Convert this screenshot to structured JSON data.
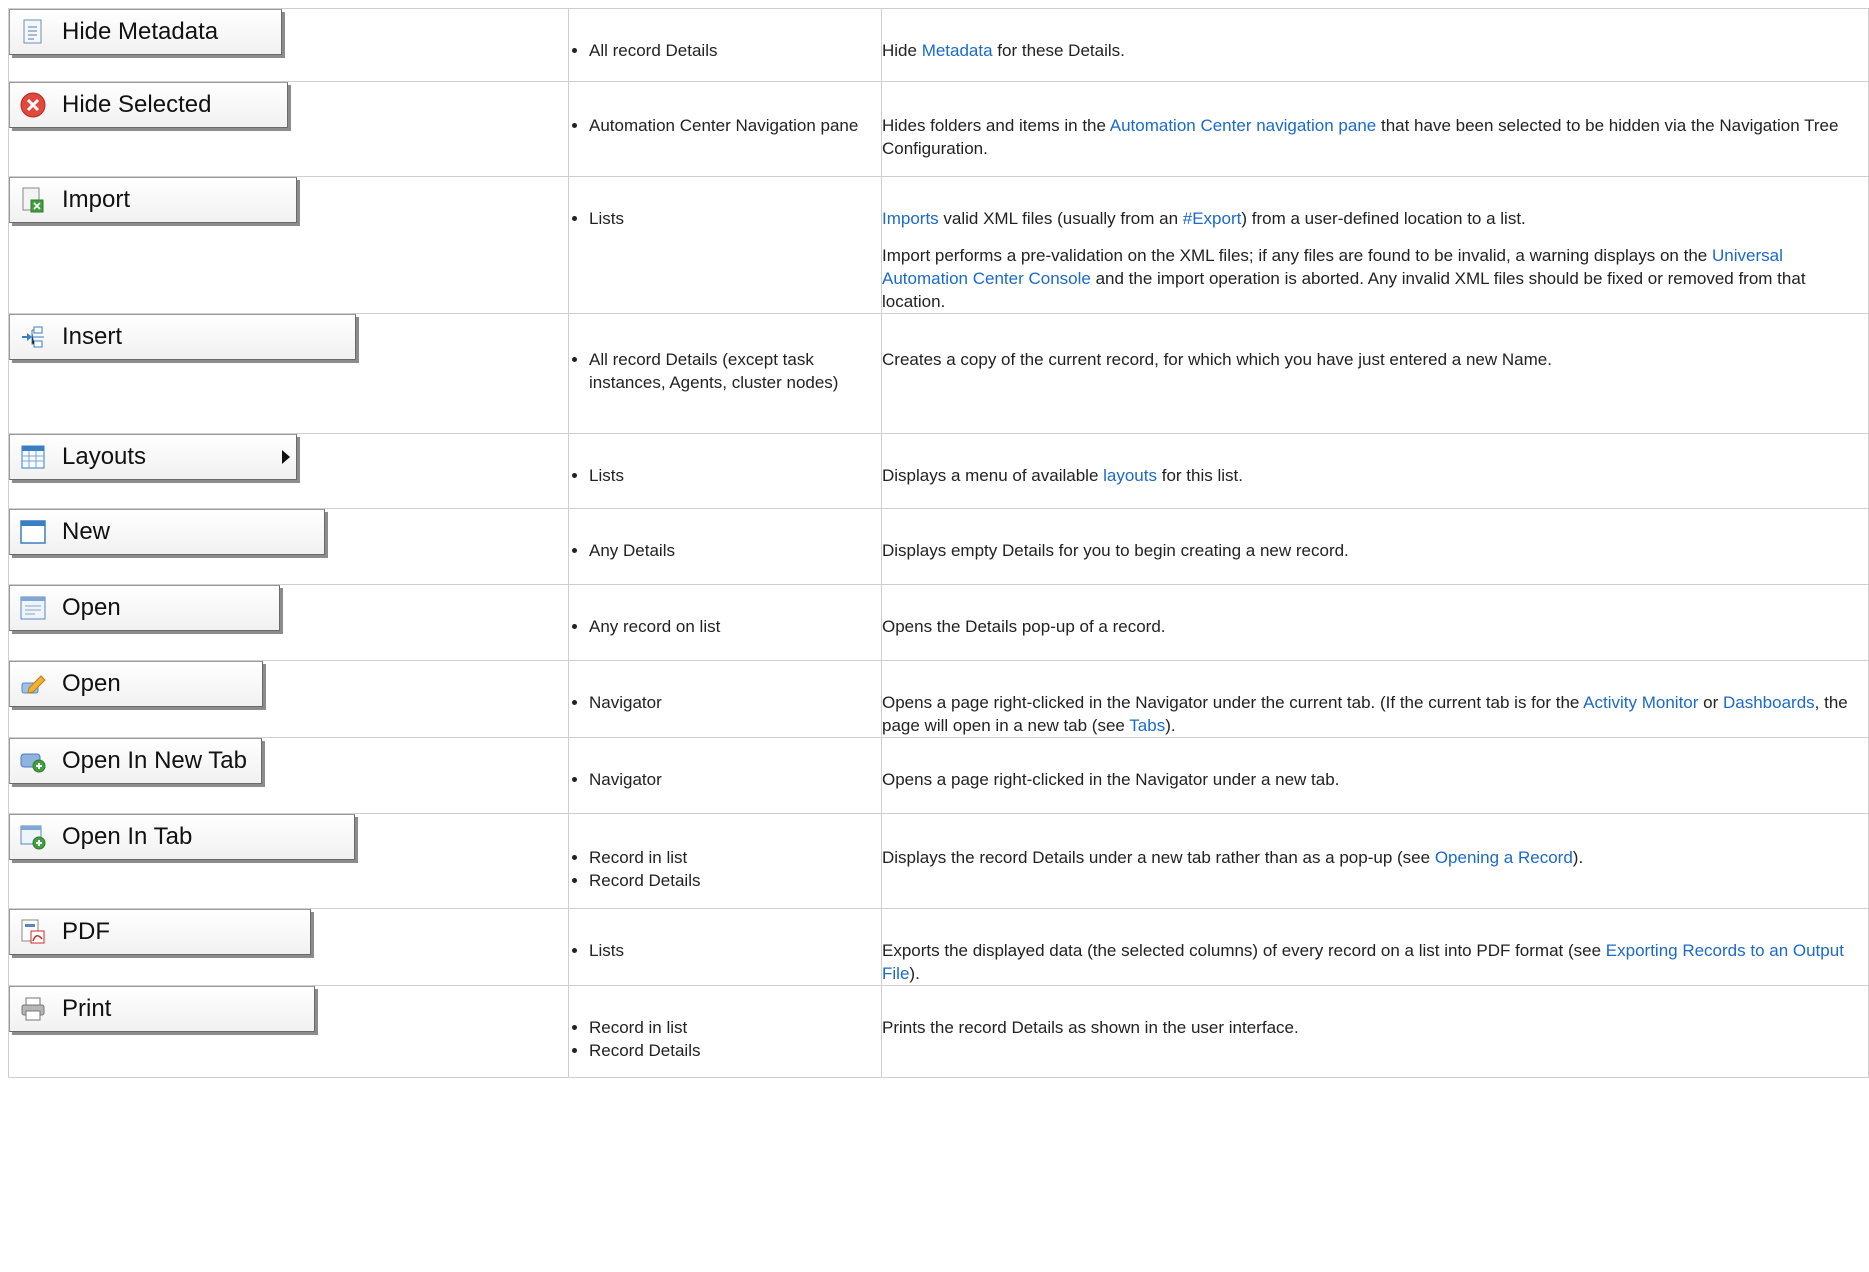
{
  "rows": [
    {
      "button": "Hide Metadata",
      "icon": "document-icon",
      "context": [
        "All record Details"
      ],
      "desc": [
        [
          "Hide ",
          ""
        ],
        [
          "Metadata",
          "link"
        ],
        [
          " for these Details.",
          ""
        ]
      ]
    },
    {
      "button": "Hide Selected",
      "icon": "red-x-circle-icon",
      "context": [
        "Automation Center Navigation pane"
      ],
      "desc": [
        [
          "Hides folders and items in the ",
          ""
        ],
        [
          "Automation Center navigation pane",
          "link"
        ],
        [
          " that have been selected to be hidden via the Navigation Tree Configuration.",
          ""
        ]
      ]
    },
    {
      "button": "Import",
      "icon": "import-icon",
      "context": [
        "Lists"
      ],
      "desc": [
        [
          "Imports",
          "link"
        ],
        [
          " valid XML files (usually from an ",
          ""
        ],
        [
          "#Export",
          "link"
        ],
        [
          ") from a user-defined location to a list.",
          ""
        ]
      ],
      "desc2": [
        [
          "Import performs a pre-validation on the XML files; if any files are found to be invalid, a warning displays on the ",
          ""
        ],
        [
          "Universal Automation Center Console",
          "link"
        ],
        [
          " and the import operation is aborted. Any invalid XML files should be fixed or removed from that location.",
          ""
        ]
      ]
    },
    {
      "button": "Insert",
      "icon": "insert-tree-icon",
      "context": [
        "All record Details (except task instances, Agents, cluster nodes)"
      ],
      "desc": [
        [
          "Creates a copy of the current record, for which which you have just entered a new Name.",
          ""
        ]
      ]
    },
    {
      "button": "Layouts",
      "icon": "layouts-grid-icon",
      "arrow": true,
      "context": [
        "Lists"
      ],
      "desc": [
        [
          "Displays a menu of available ",
          ""
        ],
        [
          "layouts",
          "link"
        ],
        [
          " for this list.",
          ""
        ]
      ]
    },
    {
      "button": "New",
      "icon": "window-icon",
      "context": [
        "Any Details"
      ],
      "desc": [
        [
          "Displays empty Details for you to begin creating a new record.",
          ""
        ]
      ]
    },
    {
      "button": "Open",
      "icon": "form-icon",
      "context": [
        "Any record on list"
      ],
      "desc": [
        [
          "Opens the Details pop-up of a record.",
          ""
        ]
      ]
    },
    {
      "button": "Open",
      "icon": "pencil-icon",
      "context": [
        "Navigator"
      ],
      "desc": [
        [
          "Opens a page right-clicked in the Navigator under the current tab. (If the current tab is for the ",
          ""
        ],
        [
          "Activity Monitor",
          "link"
        ],
        [
          " or ",
          ""
        ],
        [
          "Dashboards",
          "link"
        ],
        [
          ", the page will open in a new tab (see ",
          ""
        ],
        [
          "Tabs",
          "link"
        ],
        [
          ").",
          ""
        ]
      ]
    },
    {
      "button": "Open In New Tab",
      "icon": "new-tab-icon",
      "context": [
        "Navigator"
      ],
      "desc": [
        [
          "Opens a page right-clicked in the Navigator under a new tab.",
          ""
        ]
      ]
    },
    {
      "button": "Open In Tab",
      "icon": "open-in-tab-icon",
      "context": [
        "Record in list",
        "Record Details"
      ],
      "desc": [
        [
          "Displays the record Details under a new tab rather than as a pop-up (see ",
          ""
        ],
        [
          "Opening a Record",
          "link"
        ],
        [
          ").",
          ""
        ]
      ]
    },
    {
      "button": "PDF",
      "icon": "pdf-icon",
      "context": [
        "Lists"
      ],
      "desc": [
        [
          "Exports the displayed data (the selected columns) of every record on a list into PDF format (see ",
          ""
        ],
        [
          "Exporting Records to an Output File",
          "link"
        ],
        [
          ").",
          ""
        ]
      ]
    },
    {
      "button": "Print",
      "icon": "printer-icon",
      "context": [
        "Record in list",
        "Record Details"
      ],
      "desc": [
        [
          "Prints the record Details as shown in the user interface.",
          ""
        ]
      ]
    }
  ],
  "colors": {
    "link": "#1b6ac9",
    "border": "#cfcfcf"
  }
}
